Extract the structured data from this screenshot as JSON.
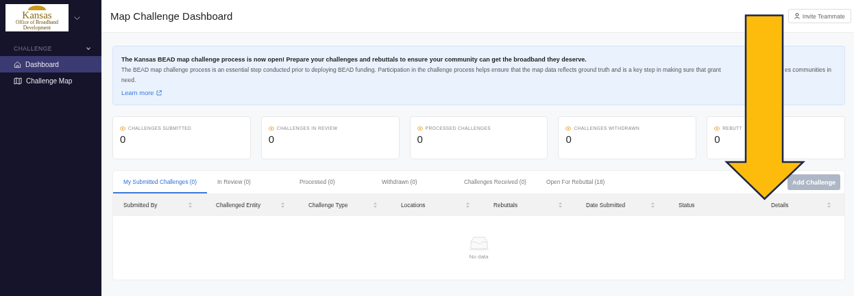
{
  "sidebar": {
    "logo": {
      "name": "Kansas",
      "subtitle": "Office of Broadband Development"
    },
    "section": {
      "label": "CHALLENGE",
      "expanded": true
    },
    "items": [
      {
        "label": "Dashboard",
        "kind": "home",
        "selected": true
      },
      {
        "label": "Challenge Map",
        "kind": "map",
        "selected": false
      }
    ]
  },
  "header": {
    "title": "Map Challenge Dashboard",
    "invite_button": "Invite Teammate"
  },
  "banner": {
    "heading": "The Kansas BEAD map challenge process is now open! Prepare your challenges and rebuttals to ensure your community can get the broadband they deserve.",
    "body_start": "The BEAD map challenge process is an essential step conducted prior to deploying BEAD funding. Participation in the challenge process helps ensure that the map data reflects ground truth and is a key step in making sure that grant",
    "body_end": "es communities in",
    "body_last": "need.",
    "link": "Learn more"
  },
  "stats": [
    {
      "label": "CHALLENGES SUBMITTED",
      "value": "0"
    },
    {
      "label": "CHALLENGES IN REVIEW",
      "value": "0"
    },
    {
      "label": "PROCESSED CHALLENGES",
      "value": "0"
    },
    {
      "label": "CHALLENGES WITHDRAWN",
      "value": "0"
    },
    {
      "label": "REBUTT",
      "value": "0"
    }
  ],
  "tabs": [
    {
      "label": "My Submitted Challenges (0)",
      "selected": true
    },
    {
      "label": "In Review (0)",
      "selected": false
    },
    {
      "label": "Processed (0)",
      "selected": false
    },
    {
      "label": "Withdrawn (0)",
      "selected": false
    },
    {
      "label": "Challenges Received (0)",
      "selected": false
    },
    {
      "label": "Open For Rebuttal (18)",
      "selected": false
    }
  ],
  "add_button": {
    "label": "Add Challenge",
    "disabled": true
  },
  "table": {
    "columns": [
      {
        "label": "Submitted By",
        "sortable": true
      },
      {
        "label": "Challenged Entity",
        "sortable": true
      },
      {
        "label": "Challenge Type",
        "sortable": true
      },
      {
        "label": "Locations",
        "sortable": true
      },
      {
        "label": "Rebuttals",
        "sortable": true
      },
      {
        "label": "Date Submitted",
        "sortable": true
      },
      {
        "label": "Status",
        "sortable": false
      },
      {
        "label": "Details",
        "sortable": true
      }
    ],
    "empty_text": "No data"
  }
}
